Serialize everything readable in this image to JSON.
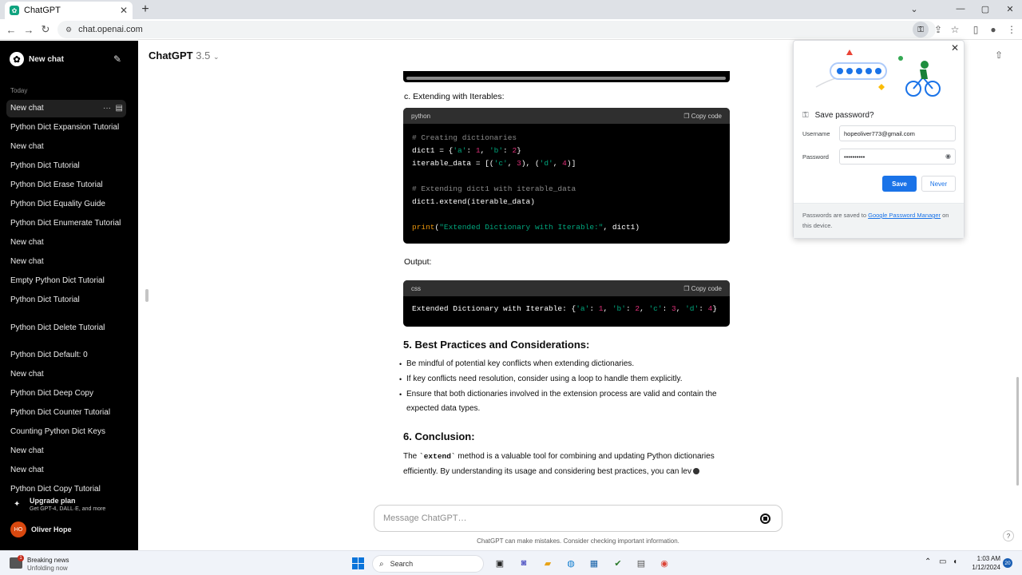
{
  "browser": {
    "tab_title": "ChatGPT",
    "url": "chat.openai.com",
    "new_tab": "+",
    "tab_close": "✕",
    "window_controls": [
      "⌄",
      "—",
      "▢",
      "✕"
    ]
  },
  "sidebar": {
    "new_chat": "New chat",
    "section_today": "Today",
    "items": [
      "New chat",
      "Python Dict Expansion Tutorial",
      "New chat",
      "Python Dict Tutorial",
      "Python Dict Erase Tutorial",
      "Python Dict Equality Guide",
      "Python Dict Enumerate Tutorial",
      "New chat",
      "New chat",
      "Empty Python Dict Tutorial",
      "Python Dict Tutorial",
      "Python Dict Delete Tutorial",
      "Python Dict Default: 0",
      "New chat",
      "Python Dict Deep Copy",
      "Python Dict Counter Tutorial",
      "Counting Python Dict Keys",
      "New chat",
      "New chat",
      "Python Dict Copy Tutorial"
    ],
    "upgrade_title": "Upgrade plan",
    "upgrade_sub": "Get GPT-4, DALL·E, and more",
    "user_initials": "HO",
    "user_name": "Oliver Hope"
  },
  "header": {
    "model": "ChatGPT",
    "version": "3.5"
  },
  "content": {
    "section_c": "c. Extending with Iterables:",
    "code1_lang": "python",
    "copy_label": "Copy code",
    "output_label": "Output:",
    "code2_lang": "css",
    "code2_text": "Extended Dictionary with Iterable: {'a': 1, 'b': 2, 'c': 3, 'd': 4}",
    "h5": "5. Best Practices and Considerations:",
    "bullets": [
      "Be mindful of potential key conflicts when extending dictionaries.",
      "If key conflicts need resolution, consider using a loop to handle them explicitly.",
      "Ensure that both dictionaries involved in the extension process are valid and contain the expected data types."
    ],
    "h6": "6. Conclusion:",
    "concl_pre": "The ",
    "concl_code": "`extend`",
    "concl_post": " method is a valuable tool for combining and updating Python dictionaries efficiently. By understanding its usage and considering best practices, you can lev"
  },
  "composer": {
    "placeholder": "Message ChatGPT…",
    "disclaimer": "ChatGPT can make mistakes. Consider checking important information.",
    "help": "?"
  },
  "password_popup": {
    "title": "Save password?",
    "username_label": "Username",
    "username_value": "hopeoliver773@gmail.com",
    "password_label": "Password",
    "password_value": "••••••••••",
    "save": "Save",
    "never": "Never",
    "footer_pre": "Passwords are saved to ",
    "footer_link": "Google Password Manager",
    "footer_post": " on this device."
  },
  "taskbar": {
    "news_title": "Breaking news",
    "news_sub": "Unfolding now",
    "news_badge": "1",
    "search": "Search",
    "time": "1:03 AM",
    "date": "1/12/2024",
    "notifications": "20"
  },
  "colors": {
    "accent": "#1a73e8",
    "sidebar_bg": "#000000",
    "code_string": "#00a67d",
    "code_number": "#df3079",
    "code_func": "#e9950c"
  }
}
